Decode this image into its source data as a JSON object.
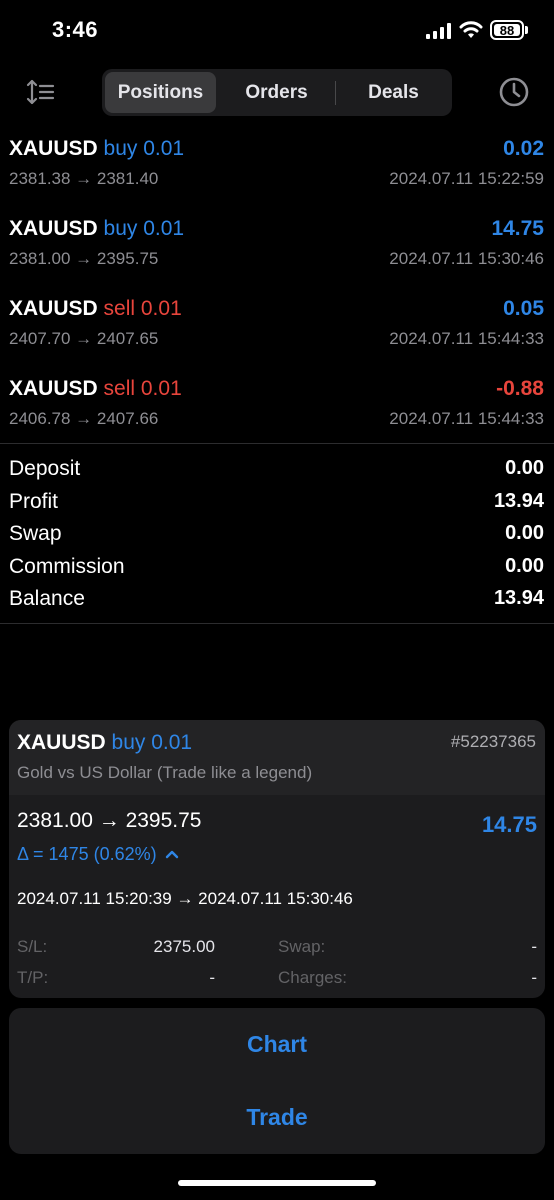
{
  "status_bar": {
    "time": "3:46",
    "battery": "88"
  },
  "tabs": [
    {
      "label": "Positions",
      "active": true
    },
    {
      "label": "Orders",
      "active": false
    },
    {
      "label": "Deals",
      "active": false
    }
  ],
  "positions": [
    {
      "symbol": "XAUUSD",
      "side": "buy 0.01",
      "prices": "2381.38 → 2381.40",
      "profit": "0.02",
      "date": "2024.07.11 15:22:59"
    },
    {
      "symbol": "XAUUSD",
      "side": "buy 0.01",
      "prices": "2381.00 → 2395.75",
      "profit": "14.75",
      "date": "2024.07.11 15:30:46"
    },
    {
      "symbol": "XAUUSD",
      "side": "sell 0.01",
      "prices": "2407.70 → 2407.65",
      "profit": "0.05",
      "date": "2024.07.11 15:44:33"
    },
    {
      "symbol": "XAUUSD",
      "side": "sell 0.01",
      "prices": "2406.78 → 2407.66",
      "profit": "-0.88",
      "date": "2024.07.11 15:44:33"
    }
  ],
  "summary": [
    {
      "label": "Deposit",
      "value": "0.00"
    },
    {
      "label": "Profit",
      "value": "13.94"
    },
    {
      "label": "Swap",
      "value": "0.00"
    },
    {
      "label": "Commission",
      "value": "0.00"
    },
    {
      "label": "Balance",
      "value": "13.94"
    }
  ],
  "detail": {
    "symbol": "XAUUSD",
    "side": "buy 0.01",
    "ticket": "#52237365",
    "description": "Gold vs US Dollar (Trade like a legend)",
    "prices": "2381.00 → 2395.75",
    "profit": "14.75",
    "delta": "Δ = 1475 (0.62%)",
    "times": "2024.07.11 15:20:39 → 2024.07.11 15:30:46",
    "sl_label": "S/L:",
    "sl_value": "2375.00",
    "tp_label": "T/P:",
    "tp_value": "-",
    "swap_label": "Swap:",
    "swap_value": "-",
    "charges_label": "Charges:",
    "charges_value": "-"
  },
  "actions": {
    "chart": "Chart",
    "trade": "Trade"
  },
  "colors": {
    "accent": "#2f86e6",
    "negative": "#e8453c",
    "background": "#000000",
    "card": "#1c1c1e"
  },
  "icons": {
    "sort": "sort-lines-icon",
    "history": "clock-icon",
    "expand": "chevron-up-icon"
  }
}
